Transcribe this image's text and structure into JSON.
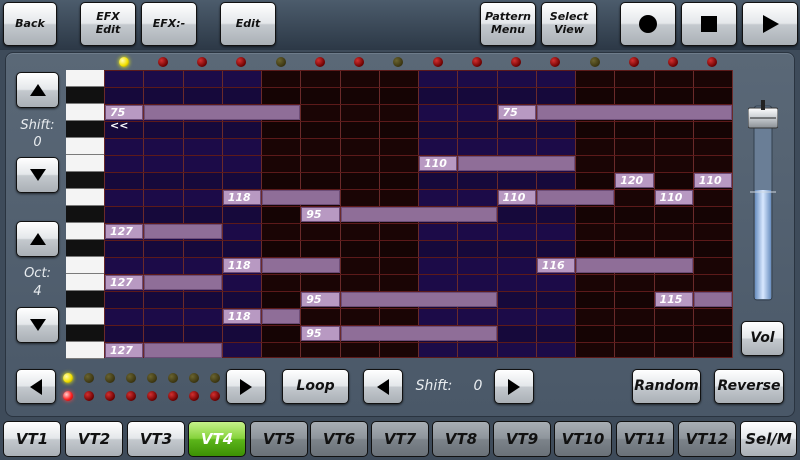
{
  "top_buttons": {
    "back": "Back",
    "efx_edit": [
      "EFX",
      "Edit"
    ],
    "efx_minus": "EFX:-",
    "edit": "Edit",
    "pattern_menu": [
      "Pattern",
      "Menu"
    ],
    "select_view": [
      "Select",
      "View"
    ],
    "record_icon": "record-icon",
    "stop_icon": "stop-icon",
    "play_icon": "play-icon"
  },
  "left_panel": {
    "shift_label": "Shift:",
    "shift_value": "0",
    "oct_label": "Oct:",
    "oct_value": "4"
  },
  "step_leds": {
    "states": [
      "on",
      "off",
      "off",
      "off",
      "dim",
      "off",
      "off",
      "dim",
      "off",
      "off",
      "off",
      "off",
      "dim",
      "off",
      "off",
      "off"
    ],
    "colors": {
      "on": "#f2e000",
      "off": "#b01818",
      "dim": "#6a6430"
    }
  },
  "sequencer": {
    "columns": 16,
    "rows": 17,
    "column_shading": [
      "blue",
      "blue",
      "blue",
      "blue",
      "dark",
      "dark",
      "dark",
      "dark",
      "blue",
      "blue",
      "blue",
      "blue",
      "dark",
      "dark",
      "dark",
      "dark"
    ],
    "piano_keys": [
      "w",
      "b",
      "w",
      "b",
      "w",
      "w",
      "b",
      "w",
      "b",
      "w",
      "b",
      "w",
      "w",
      "b",
      "w",
      "b",
      "w"
    ],
    "notes": [
      {
        "row": 2,
        "col": 0,
        "len": 1,
        "label": "75 <<"
      },
      {
        "row": 2,
        "col": 1,
        "len": 4,
        "label": ""
      },
      {
        "row": 2,
        "col": 10,
        "len": 1,
        "label": "75"
      },
      {
        "row": 2,
        "col": 11,
        "len": 5,
        "label": ""
      },
      {
        "row": 5,
        "col": 8,
        "len": 1,
        "label": "110"
      },
      {
        "row": 5,
        "col": 9,
        "len": 3,
        "label": ""
      },
      {
        "row": 6,
        "col": 13,
        "len": 1,
        "label": "120"
      },
      {
        "row": 6,
        "col": 15,
        "len": 1,
        "label": "110"
      },
      {
        "row": 7,
        "col": 3,
        "len": 1,
        "label": "118"
      },
      {
        "row": 7,
        "col": 4,
        "len": 2,
        "label": ""
      },
      {
        "row": 7,
        "col": 10,
        "len": 1,
        "label": "110"
      },
      {
        "row": 7,
        "col": 11,
        "len": 2,
        "label": ""
      },
      {
        "row": 7,
        "col": 14,
        "len": 1,
        "label": "110"
      },
      {
        "row": 8,
        "col": 5,
        "len": 1,
        "label": "95"
      },
      {
        "row": 8,
        "col": 6,
        "len": 4,
        "label": ""
      },
      {
        "row": 9,
        "col": 0,
        "len": 1,
        "label": "127"
      },
      {
        "row": 9,
        "col": 1,
        "len": 2,
        "label": ""
      },
      {
        "row": 11,
        "col": 3,
        "len": 1,
        "label": "118"
      },
      {
        "row": 11,
        "col": 4,
        "len": 2,
        "label": ""
      },
      {
        "row": 11,
        "col": 11,
        "len": 1,
        "label": "116"
      },
      {
        "row": 11,
        "col": 12,
        "len": 3,
        "label": ""
      },
      {
        "row": 12,
        "col": 0,
        "len": 1,
        "label": "127"
      },
      {
        "row": 12,
        "col": 1,
        "len": 2,
        "label": ""
      },
      {
        "row": 13,
        "col": 5,
        "len": 1,
        "label": "95"
      },
      {
        "row": 13,
        "col": 6,
        "len": 4,
        "label": ""
      },
      {
        "row": 13,
        "col": 14,
        "len": 1,
        "label": "115"
      },
      {
        "row": 13,
        "col": 15,
        "len": 1,
        "label": ""
      },
      {
        "row": 14,
        "col": 3,
        "len": 1,
        "label": "118"
      },
      {
        "row": 14,
        "col": 4,
        "len": 1,
        "label": ""
      },
      {
        "row": 15,
        "col": 5,
        "len": 1,
        "label": "95"
      },
      {
        "row": 15,
        "col": 6,
        "len": 4,
        "label": ""
      },
      {
        "row": 16,
        "col": 0,
        "len": 1,
        "label": "127"
      },
      {
        "row": 16,
        "col": 1,
        "len": 2,
        "label": ""
      }
    ]
  },
  "volume": {
    "label": "Vol",
    "level": 0.55
  },
  "bottom_controls": {
    "page_leds_top": [
      "on",
      "dim",
      "dim",
      "dim",
      "dim",
      "dim",
      "dim",
      "dim"
    ],
    "page_leds_bottom": [
      "on",
      "off",
      "off",
      "off",
      "off",
      "off",
      "off",
      "off"
    ],
    "loop": "Loop",
    "shift_label": "Shift:",
    "shift_value": "0",
    "random": "Random",
    "reverse": "Reverse"
  },
  "tracks": {
    "items": [
      "VT1",
      "VT2",
      "VT3",
      "VT4",
      "VT5",
      "VT6",
      "VT7",
      "VT8",
      "VT9",
      "VT10",
      "VT11",
      "VT12",
      "Sel/M"
    ],
    "active": "VT4"
  }
}
